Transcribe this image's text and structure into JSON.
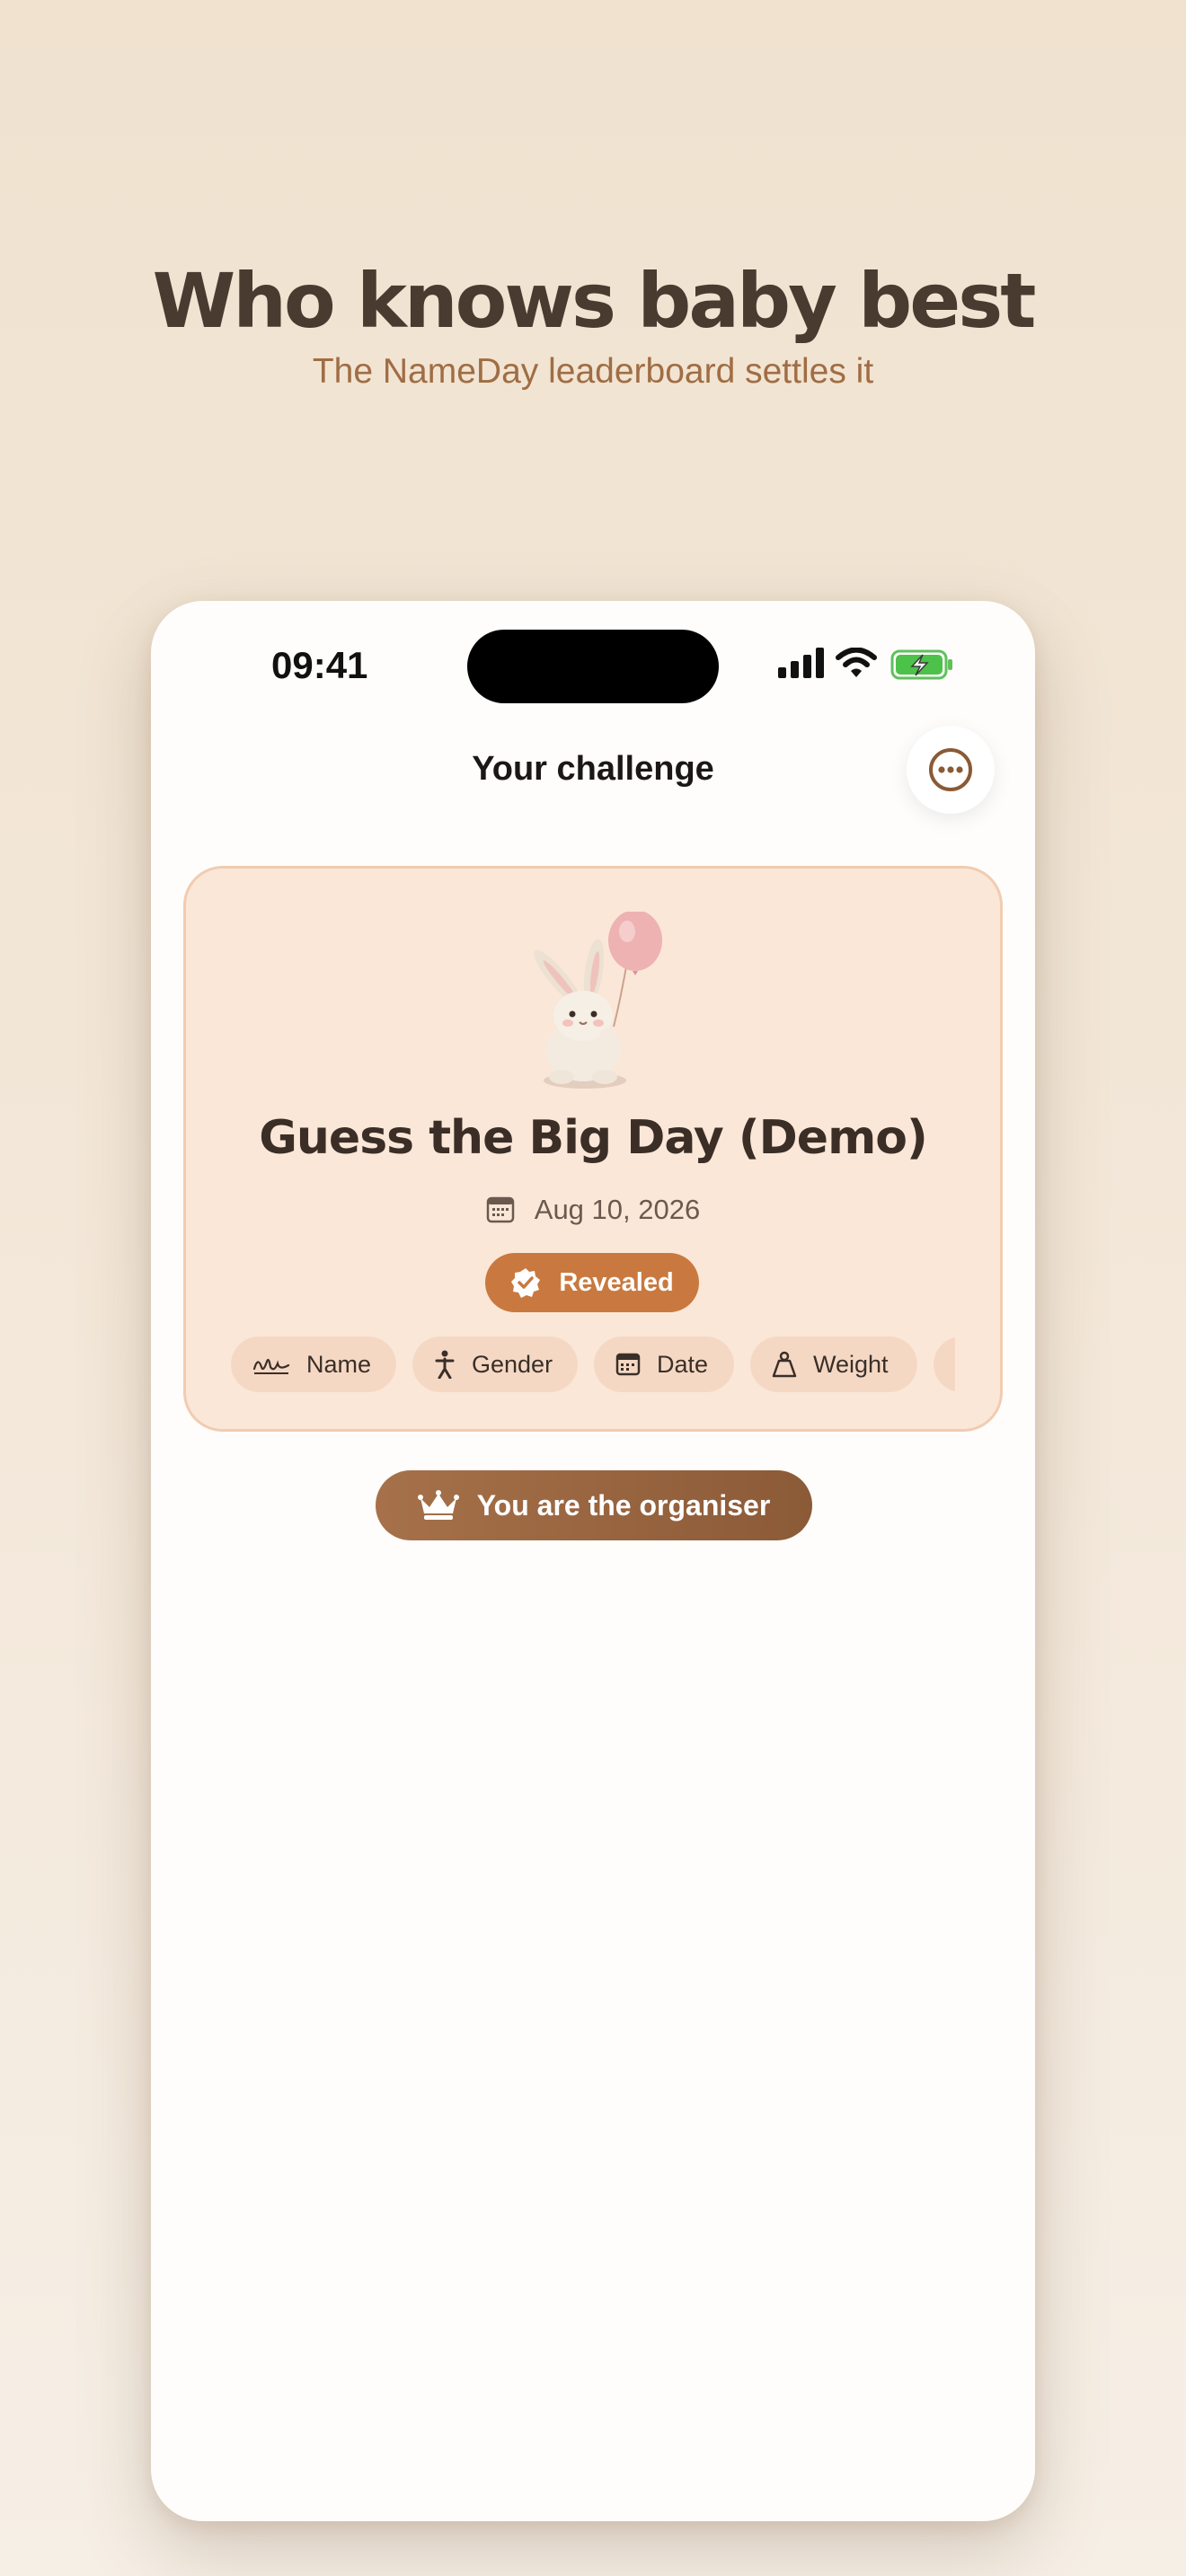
{
  "marketing": {
    "headline": "Who knows baby best",
    "subheadline": "The NameDay leaderboard settles it"
  },
  "status_bar": {
    "time": "09:41",
    "icons": [
      "cellular-signal-icon",
      "wifi-icon",
      "battery-charging-icon"
    ]
  },
  "nav": {
    "title": "Your challenge",
    "more_icon": "ellipsis-circle-icon"
  },
  "challenge_card": {
    "image": "bunny-with-balloon",
    "title": "Guess the Big Day (Demo)",
    "date": "Aug 10, 2026",
    "status_badge": "Revealed",
    "categories": [
      {
        "label": "Name",
        "icon": "signature-icon"
      },
      {
        "label": "Gender",
        "icon": "person-icon"
      },
      {
        "label": "Date",
        "icon": "calendar-icon"
      },
      {
        "label": "Weight",
        "icon": "weight-icon"
      }
    ]
  },
  "organiser_badge": {
    "label": "You are the organiser",
    "icon": "crown-icon"
  },
  "colors": {
    "accent_orange": "#c9793f",
    "organiser_brown": "#8b5a37",
    "card_background": "#fbe7d8",
    "headline_text": "#4a3b31",
    "subheadline_text": "#a06d44"
  }
}
